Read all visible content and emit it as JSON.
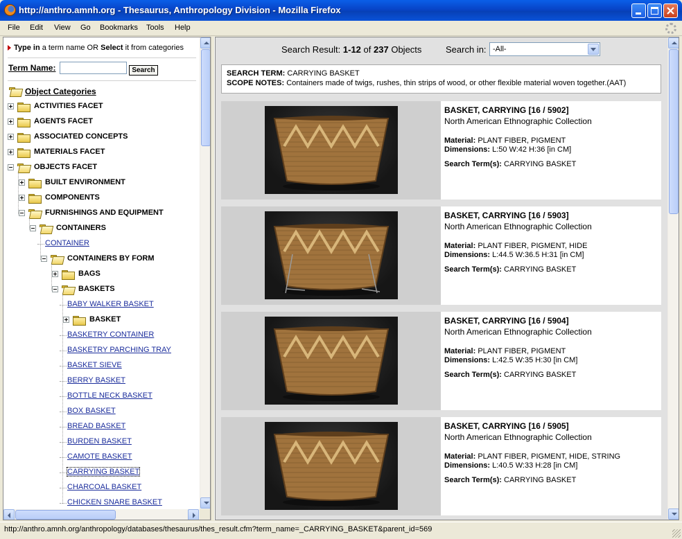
{
  "window": {
    "title": "http://anthro.amnh.org - Thesaurus, Anthropology Division - Mozilla Firefox"
  },
  "menu": [
    "File",
    "Edit",
    "View",
    "Go",
    "Bookmarks",
    "Tools",
    "Help"
  ],
  "left": {
    "intro": {
      "type_in": "Type in",
      "middle": " a term name OR ",
      "select": "Select",
      "rest": " it from categories"
    },
    "term_label": "Term Name:",
    "term_value": "",
    "search_button": "Search",
    "categories_title": "Object Categories",
    "tree": [
      {
        "label": "ACTIVITIES FACET",
        "level": 0,
        "kind": "folder",
        "state": "collapsed"
      },
      {
        "label": "AGENTS FACET",
        "level": 0,
        "kind": "folder",
        "state": "collapsed"
      },
      {
        "label": "ASSOCIATED CONCEPTS",
        "level": 0,
        "kind": "folder",
        "state": "collapsed"
      },
      {
        "label": "MATERIALS FACET",
        "level": 0,
        "kind": "folder",
        "state": "collapsed"
      },
      {
        "label": "OBJECTS FACET",
        "level": 0,
        "kind": "folder",
        "state": "expanded"
      },
      {
        "label": "BUILT ENVIRONMENT",
        "level": 1,
        "kind": "folder",
        "state": "collapsed"
      },
      {
        "label": "COMPONENTS",
        "level": 1,
        "kind": "folder",
        "state": "collapsed"
      },
      {
        "label": "FURNISHINGS AND EQUIPMENT",
        "level": 1,
        "kind": "folder",
        "state": "expanded"
      },
      {
        "label": "CONTAINERS",
        "level": 2,
        "kind": "folder",
        "state": "expanded"
      },
      {
        "label": "CONTAINER",
        "level": 3,
        "kind": "link"
      },
      {
        "label": "CONTAINERS BY FORM",
        "level": 3,
        "kind": "folder",
        "state": "expanded"
      },
      {
        "label": "BAGS",
        "level": 4,
        "kind": "folder",
        "state": "collapsed"
      },
      {
        "label": "BASKETS",
        "level": 4,
        "kind": "folder",
        "state": "expanded"
      },
      {
        "label": "BABY WALKER BASKET",
        "level": 5,
        "kind": "link"
      },
      {
        "label": "BASKET",
        "level": 5,
        "kind": "folder",
        "state": "collapsed"
      },
      {
        "label": "BASKETRY CONTAINER",
        "level": 5,
        "kind": "link"
      },
      {
        "label": "BASKETRY PARCHING TRAY",
        "level": 5,
        "kind": "link"
      },
      {
        "label": "BASKET SIEVE",
        "level": 5,
        "kind": "link"
      },
      {
        "label": "BERRY BASKET",
        "level": 5,
        "kind": "link"
      },
      {
        "label": "BOTTLE NECK BASKET",
        "level": 5,
        "kind": "link"
      },
      {
        "label": "BOX BASKET",
        "level": 5,
        "kind": "link"
      },
      {
        "label": "BREAD BASKET",
        "level": 5,
        "kind": "link"
      },
      {
        "label": "BURDEN BASKET",
        "level": 5,
        "kind": "link"
      },
      {
        "label": "CAMOTE BASKET",
        "level": 5,
        "kind": "link"
      },
      {
        "label": "CARRYING BASKET",
        "level": 5,
        "kind": "link",
        "focused": true
      },
      {
        "label": "CHARCOAL BASKET",
        "level": 5,
        "kind": "link"
      },
      {
        "label": "CHICKEN SNARE BASKET",
        "level": 5,
        "kind": "link"
      }
    ]
  },
  "results": {
    "label": "Search Result:",
    "range": "1-12",
    "of_text": "of",
    "total": "237",
    "unit": "Objects",
    "search_in_label": "Search in:",
    "search_in_value": "-All-",
    "search_term_label": "SEARCH TERM:",
    "search_term": "CARRYING BASKET",
    "scope_label": "SCOPE NOTES:",
    "scope_notes": "Containers made of twigs, rushes, thin strips of wood, or other flexible material woven together.(AAT)",
    "material_label": "Material:",
    "dimensions_label": "Dimensions:",
    "search_terms_label": "Search Term(s):",
    "items": [
      {
        "title": "BASKET, CARRYING [16 / 5902]",
        "collection": "North American Ethnographic Collection",
        "material": "PLANT FIBER, PIGMENT",
        "dimensions": "L:50 W:42 H:36 [in CM]",
        "terms": "CARRYING BASKET"
      },
      {
        "title": "BASKET, CARRYING [16 / 5903]",
        "collection": "North American Ethnographic Collection",
        "material": "PLANT FIBER, PIGMENT, HIDE",
        "dimensions": "L:44.5 W:36.5 H:31 [in CM]",
        "terms": "CARRYING BASKET"
      },
      {
        "title": "BASKET, CARRYING [16 / 5904]",
        "collection": "North American Ethnographic Collection",
        "material": "PLANT FIBER, PIGMENT",
        "dimensions": "L:42.5 W:35 H:30 [in CM]",
        "terms": "CARRYING BASKET"
      },
      {
        "title": "BASKET, CARRYING [16 / 5905]",
        "collection": "North American Ethnographic Collection",
        "material": "PLANT FIBER, PIGMENT, HIDE, STRING",
        "dimensions": "L:40.5 W:33 H:28 [in CM]",
        "terms": "CARRYING BASKET"
      }
    ]
  },
  "status": {
    "text": "http://anthro.amnh.org/anthropology/databases/thesaurus/thes_result.cfm?term_name=_CARRYING_BASKET&parent_id=569"
  },
  "colors": {
    "link": "#1B2D9C",
    "titlebar": "#0A52D8",
    "close_button": "#C8401D"
  }
}
